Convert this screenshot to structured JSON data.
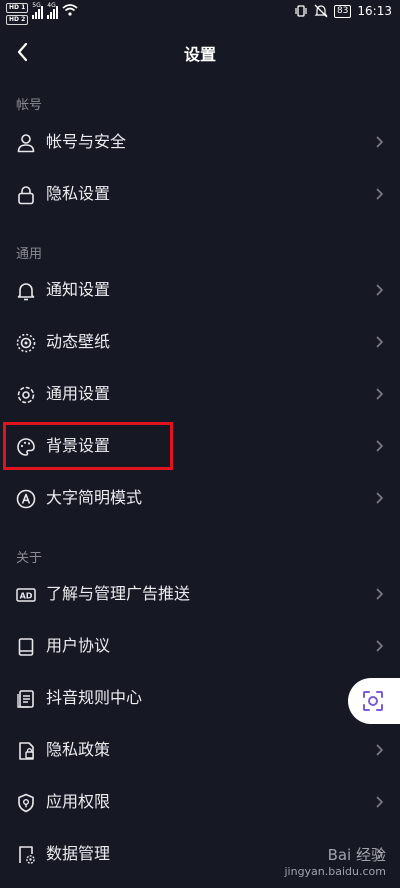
{
  "status": {
    "hd1": "HD 1",
    "hd2": "HD 2",
    "net1": "5G",
    "net2": "4G",
    "battery": "83",
    "time": "16:13"
  },
  "header": {
    "title": "设置"
  },
  "sections": {
    "account": "帐号",
    "general": "通用",
    "about": "关于"
  },
  "rows": {
    "account_security": "帐号与安全",
    "privacy_settings": "隐私设置",
    "notification_settings": "通知设置",
    "dynamic_wallpaper": "动态壁纸",
    "general_settings": "通用设置",
    "background_settings": "背景设置",
    "large_font_mode": "大字简明模式",
    "ad_push": "了解与管理广告推送",
    "user_agreement": "用户协议",
    "douyin_rules": "抖音规则中心",
    "privacy_policy": "隐私政策",
    "app_permissions": "应用权限",
    "data_management": "数据管理"
  },
  "watermark": {
    "brand": "Bai 经验",
    "site": "jingyan.baidu.com"
  }
}
